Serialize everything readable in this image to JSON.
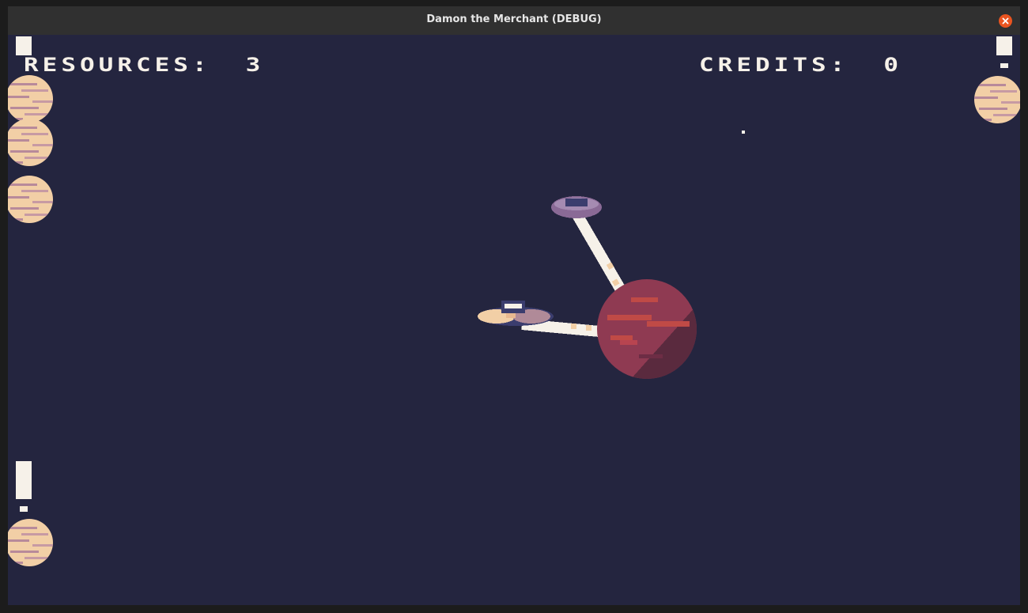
{
  "window": {
    "title": "Damon the Merchant (DEBUG)"
  },
  "hud": {
    "resources_label": "RESOURCES:",
    "resources_value": "3",
    "credits_label": "CREDITS:",
    "credits_value": "0"
  },
  "colors": {
    "space_bg": "#24253f",
    "titlebar": "#303030",
    "close_button": "#e95420",
    "hud_text": "#f6f1e9",
    "sand_planet": "#f2cfa6",
    "red_planet": "#8f3a52",
    "station_purple": "#8a6a96"
  },
  "icons": {
    "close": "close-icon",
    "planet_sand": "sand-planet-icon",
    "planet_red": "red-planet-icon",
    "ship": "cargo-ship-icon",
    "station": "space-station-icon"
  }
}
